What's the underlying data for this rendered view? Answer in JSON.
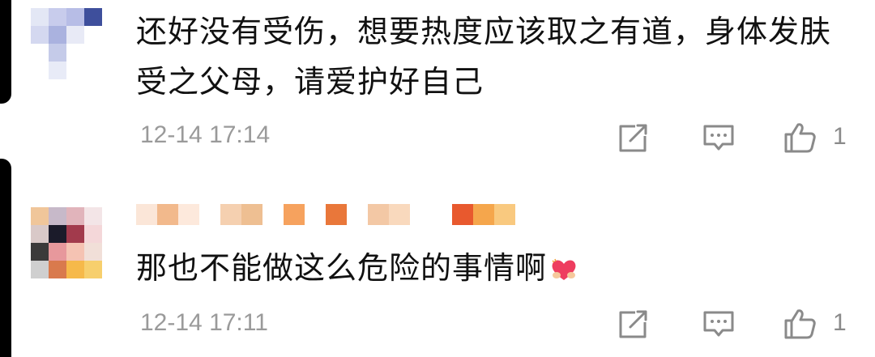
{
  "comments": [
    {
      "text": "还好没有受伤，想要热度应该取之有道，身体发肤受之父母，请爱护好自己",
      "time": "12-14 17:14",
      "likes": "1",
      "avatar_colors": [
        "#e3e7f5",
        "#c8ccec",
        "#b7bde6",
        "#3e4f9c",
        "#d4d8f0",
        "#aab2df",
        "#e8eaf6",
        "#ffffff",
        "#ffffff",
        "#c5cbe9",
        "#ffffff",
        "#ffffff",
        "#ffffff",
        "#e8ebf7",
        "#ffffff",
        "#ffffff"
      ],
      "username_colors": []
    },
    {
      "text": "那也不能做这么危险的事情啊",
      "time": "12-14 17:11",
      "likes": "1",
      "avatar_colors": [
        "#f0c69a",
        "#c7b9c9",
        "#e1b4bb",
        "#f3e5e7",
        "#d9c9c8",
        "#1b1b2a",
        "#a23a4c",
        "#f4d7d9",
        "#3b3a3a",
        "#e7989c",
        "#f5c3b3",
        "#f1dfd8",
        "#cfcfcf",
        "#d97a4d",
        "#f6b94a",
        "#f7cf6d"
      ],
      "username_colors": [
        "#fbe6d8",
        "#f2b98c",
        "#fde9dc",
        "#ffffff",
        "#f5d0b0",
        "#eebf92",
        "#ffffff",
        "#f6a25e",
        "#ffffff",
        "#e9773a",
        "#ffffff",
        "#f3c8a5",
        "#f9d9bd",
        "#ffffff",
        "#ffffff",
        "#e8592e",
        "#f5a64c",
        "#f9c97f"
      ]
    }
  ],
  "icons": {
    "forward": "share-square-icon",
    "reply": "comment-bubble-icon",
    "like": "thumbs-up-icon"
  },
  "colors": {
    "text": "#111111",
    "meta": "#9a9a9a",
    "icon": "#8a8a8a"
  }
}
